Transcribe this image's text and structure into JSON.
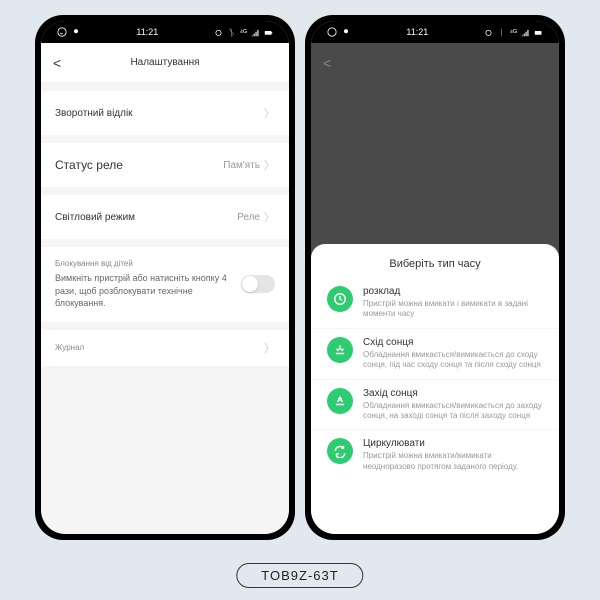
{
  "product_code": "TOB9Z-63T",
  "status": {
    "time": "11:21"
  },
  "left": {
    "title": "Налаштування",
    "rows": {
      "countdown": {
        "label": "Зворотний відлік"
      },
      "relay": {
        "label": "Статус реле",
        "value": "Пам'ять"
      },
      "light": {
        "label": "Світловий режим",
        "value": "Реле"
      }
    },
    "lock": {
      "heading": "Блокування від дітей",
      "desc": "Вимкніть пристрій або натисніть кнопку 4 рази, щоб розблокувати технічне блокування."
    },
    "journal": "Журнал"
  },
  "right": {
    "sheet_title": "Виберіть тип часу",
    "options": [
      {
        "icon": "clock",
        "title": "розклад",
        "desc": "Пристрій можна вмикати і вимикати в задані моменти часу"
      },
      {
        "icon": "sunrise",
        "title": "Схід сонця",
        "desc": "Обладнання вмикається/вимикається до сходу сонця, під час сходу сонця та після сходу сонця"
      },
      {
        "icon": "sunset",
        "title": "Захід сонця",
        "desc": "Обладнання вмикається/вимикається до заходу сонця, на заході сонця та після заходу сонця"
      },
      {
        "icon": "cycle",
        "title": "Циркулювати",
        "desc": "Пристрій можна вмикати/вимикати неодноразово протягом заданого періоду."
      }
    ]
  }
}
